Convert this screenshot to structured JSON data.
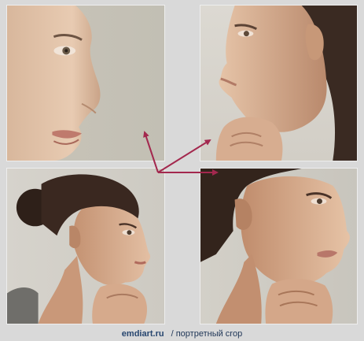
{
  "caption": {
    "site": "emdiart.ru",
    "separator": "/",
    "label": "портретный crop"
  },
  "colors": {
    "background": "#d9d9d9",
    "arrow": "#a3284e",
    "caption_text": "#1e3556"
  },
  "tiles": [
    {
      "name": "tight-profile-crop",
      "subject": "face-profile-icon"
    },
    {
      "name": "profile-with-hand-crop",
      "subject": "face-profile-icon"
    },
    {
      "name": "wide-portrait-crop",
      "subject": "face-profile-icon"
    },
    {
      "name": "medium-portrait-crop",
      "subject": "face-profile-icon"
    }
  ]
}
